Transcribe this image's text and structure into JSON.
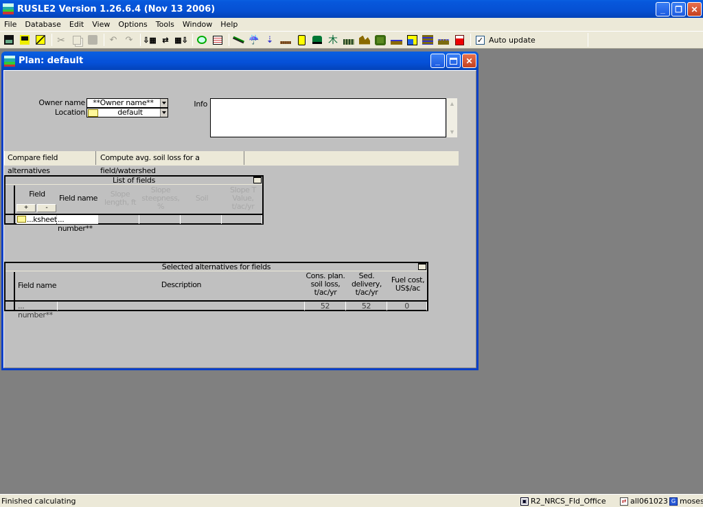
{
  "app": {
    "title": "RUSLE2 Version 1.26.6.4 (Nov 13 2006)",
    "window_controls": {
      "minimize": "_",
      "restore": "❐",
      "close": "✕"
    }
  },
  "menu": {
    "items": [
      "File",
      "Database",
      "Edit",
      "View",
      "Options",
      "Tools",
      "Window",
      "Help"
    ]
  },
  "toolbar": {
    "buttons": [
      {
        "name": "save-icon",
        "enabled": true
      },
      {
        "name": "save-all-icon",
        "enabled": true
      },
      {
        "name": "objects-icon",
        "enabled": true
      },
      {
        "name": "cut-icon",
        "enabled": false
      },
      {
        "name": "copy-icon",
        "enabled": false
      },
      {
        "name": "paste-icon",
        "enabled": false
      },
      {
        "name": "undo-icon",
        "enabled": false
      },
      {
        "name": "redo-icon",
        "enabled": false
      },
      {
        "name": "import-icon",
        "enabled": true
      },
      {
        "name": "swap-icon",
        "enabled": true
      },
      {
        "name": "export-icon",
        "enabled": true
      },
      {
        "name": "map-icon",
        "enabled": true
      },
      {
        "name": "table-icon",
        "enabled": true
      },
      {
        "name": "profile-icon",
        "enabled": true
      },
      {
        "name": "climate-icon",
        "enabled": true
      },
      {
        "name": "soil-icon",
        "enabled": true
      },
      {
        "name": "residue-icon",
        "enabled": true
      },
      {
        "name": "fuel-icon",
        "enabled": true
      },
      {
        "name": "tractor-icon",
        "enabled": true
      },
      {
        "name": "vegetation-icon",
        "enabled": true
      },
      {
        "name": "crop-icon",
        "enabled": true
      },
      {
        "name": "hill-icon",
        "enabled": true
      },
      {
        "name": "field-icon",
        "enabled": true
      },
      {
        "name": "channel-icon",
        "enabled": true
      },
      {
        "name": "impoundment-icon",
        "enabled": true
      },
      {
        "name": "terrace-icon",
        "enabled": true
      },
      {
        "name": "irrigation-icon",
        "enabled": true
      },
      {
        "name": "fuel-pump-icon",
        "enabled": true
      }
    ],
    "auto_update_label": "Auto update",
    "auto_update_checked": true
  },
  "plan_window": {
    "title": "Plan:  default",
    "owner_label": "Owner name",
    "owner_value": "**Owner name**",
    "location_label": "Location",
    "location_value": "default",
    "info_label": "Info",
    "info_value": "",
    "tabs": [
      {
        "label": "Compare field alternatives",
        "active": true
      },
      {
        "label": "Compute avg. soil loss for a field/watershed",
        "active": false
      }
    ],
    "list_of_fields": {
      "title": "List of fields",
      "headers": {
        "field": "Field",
        "field_name": "Field name",
        "slope_length": [
          "Slope",
          "length, ft"
        ],
        "slope_steepness": [
          "Slope",
          "steepness,",
          "%"
        ],
        "soil": "Soil",
        "slope_t": [
          "Slope T",
          "Value,",
          "t/ac/yr"
        ]
      },
      "add_label": "+",
      "remove_label": "-",
      "rows": [
        {
          "field": "...ksheet",
          "field_name": "... number**",
          "slope_length": "",
          "slope_steepness": "",
          "soil": "",
          "slope_t": ""
        }
      ]
    },
    "selected_alternatives": {
      "title": "Selected alternatives for fields",
      "headers": {
        "field_name": "Field name",
        "description": "Description",
        "cons_plan": [
          "Cons. plan.",
          "soil loss,",
          "t/ac/yr"
        ],
        "sed_delivery": [
          "Sed.",
          "delivery,",
          "t/ac/yr"
        ],
        "fuel_cost": [
          "Fuel cost,",
          "US$/ac"
        ]
      },
      "rows": [
        {
          "field_name": "... number**",
          "description": "",
          "cons_plan": "52",
          "sed_delivery": "52",
          "fuel_cost": "0"
        }
      ]
    }
  },
  "status_bar": {
    "message": "Finished calculating",
    "database": "R2_NRCS_Fld_Office",
    "data_set": "all061023",
    "user": "moses"
  }
}
